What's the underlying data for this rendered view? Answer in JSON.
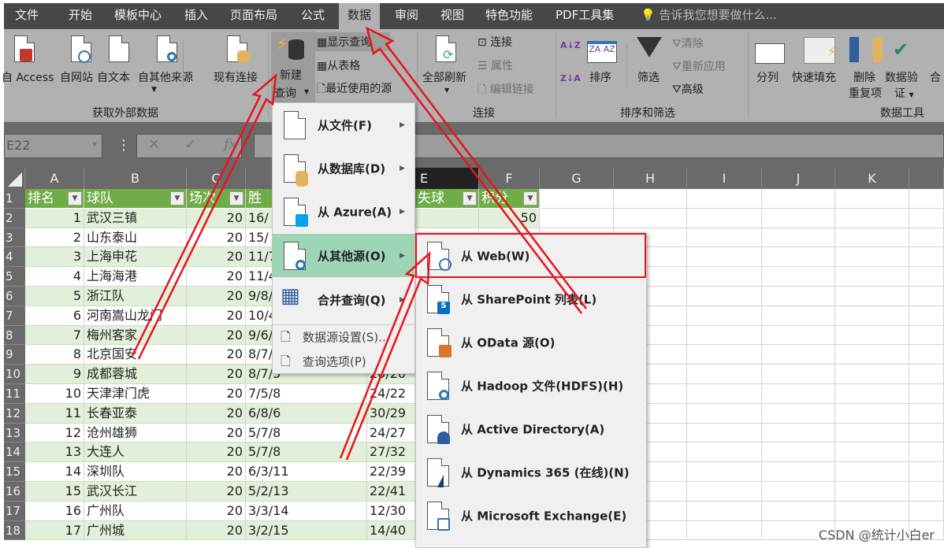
{
  "tabs": [
    "文件",
    "开始",
    "模板中心",
    "插入",
    "页面布局",
    "公式",
    "数据",
    "审阅",
    "视图",
    "特色功能",
    "PDF工具集"
  ],
  "active_tab": "数据",
  "tell_me": "告诉我您想要做什么...",
  "ribbon": {
    "get_external": {
      "access": "自 Access",
      "web": "自网站",
      "text": "自文本",
      "other": "自其他来源",
      "existing": "现有连接",
      "label": "获取外部数据"
    },
    "new_query": {
      "line1": "新建",
      "line2": "查询",
      "show_queries": "显示查询",
      "from_table": "从表格",
      "recent_sources": "最近使用的源"
    },
    "connections": {
      "refresh_all": "全部刷新",
      "connections": "连接",
      "properties": "属性",
      "edit_links": "编辑链接",
      "label": "连接"
    },
    "sort_filter": {
      "sort": "排序",
      "filter": "筛选",
      "clear": "清除",
      "reapply": "重新应用",
      "advanced": "高级",
      "label": "排序和筛选",
      "az": "A↓Z",
      "za": "Z↓A"
    },
    "data_tools": {
      "text_to_columns": "分列",
      "flash_fill": "快速填充",
      "remove_dup1": "删除",
      "remove_dup2": "重复项",
      "validation1": "数据验",
      "validation2": "证",
      "consolidate": "合",
      "label": "数据工具"
    }
  },
  "name_box": "E22",
  "fx": "fx",
  "columns": [
    "A",
    "B",
    "C",
    "E",
    "F",
    "G",
    "H",
    "I",
    "J",
    "K"
  ],
  "header_row": [
    "排名",
    "球队",
    "场次",
    "胜",
    "失球",
    "积分"
  ],
  "rows": [
    {
      "n": "2",
      "rank": "1",
      "team": "武汉三镇",
      "games": "20",
      "wdl": "16/",
      "gf": "",
      "pts": "50"
    },
    {
      "n": "3",
      "rank": "2",
      "team": "山东泰山",
      "games": "20",
      "wdl": "15/",
      "gf": ""
    },
    {
      "n": "4",
      "rank": "3",
      "team": "上海申花",
      "games": "20",
      "wdl": "11/7",
      "gf": ""
    },
    {
      "n": "5",
      "rank": "4",
      "team": "上海海港",
      "games": "20",
      "wdl": "11/4",
      "gf": ""
    },
    {
      "n": "6",
      "rank": "5",
      "team": "浙江队",
      "games": "20",
      "wdl": "9/8/",
      "gf": ""
    },
    {
      "n": "7",
      "rank": "6",
      "team": "河南嵩山龙门",
      "games": "20",
      "wdl": "10/4",
      "gf": ""
    },
    {
      "n": "8",
      "rank": "7",
      "team": "梅州客家",
      "games": "20",
      "wdl": "9/6/",
      "gf": ""
    },
    {
      "n": "9",
      "rank": "8",
      "team": "北京国安",
      "games": "20",
      "wdl": "8/7/",
      "gf": ""
    },
    {
      "n": "10",
      "rank": "9",
      "team": "成都蓉城",
      "games": "20",
      "wdl": "8/7/5",
      "gf": "20/20"
    },
    {
      "n": "11",
      "rank": "10",
      "team": "天津津门虎",
      "games": "20",
      "wdl": "7/5/8",
      "gf": "24/22"
    },
    {
      "n": "12",
      "rank": "11",
      "team": "长春亚泰",
      "games": "20",
      "wdl": "6/8/6",
      "gf": "30/29"
    },
    {
      "n": "13",
      "rank": "12",
      "team": "沧州雄狮",
      "games": "20",
      "wdl": "5/7/8",
      "gf": "24/27"
    },
    {
      "n": "14",
      "rank": "13",
      "team": "大连人",
      "games": "20",
      "wdl": "5/7/8",
      "gf": "27/32"
    },
    {
      "n": "15",
      "rank": "14",
      "team": "深圳队",
      "games": "20",
      "wdl": "6/3/11",
      "gf": "22/39"
    },
    {
      "n": "16",
      "rank": "15",
      "team": "武汉长江",
      "games": "20",
      "wdl": "5/2/13",
      "gf": "22/41"
    },
    {
      "n": "17",
      "rank": "16",
      "team": "广州队",
      "games": "20",
      "wdl": "3/3/14",
      "gf": "12/30"
    },
    {
      "n": "18",
      "rank": "17",
      "team": "广州城",
      "games": "20",
      "wdl": "3/2/15",
      "gf": "14/40"
    }
  ],
  "new_query_menu": [
    {
      "label": "从文件(F)",
      "icon": "file-icon"
    },
    {
      "label": "从数据库(D)",
      "icon": "database-icon"
    },
    {
      "label": "从 Azure(A)",
      "icon": "azure-icon"
    },
    {
      "label": "从其他源(O)",
      "icon": "other-sources-icon",
      "highlighted": true
    },
    {
      "label": "合并查询(Q)",
      "icon": "combine-queries-icon"
    },
    {
      "label": "数据源设置(S)...",
      "icon": "data-source-settings-icon"
    },
    {
      "label": "查询选项(P)",
      "icon": "query-options-icon"
    }
  ],
  "other_sources_menu": [
    {
      "label": "从 Web(W)",
      "icon": "globe-icon",
      "highlighted_box": true
    },
    {
      "label": "从 SharePoint 列表(L)",
      "icon": "sharepoint-icon"
    },
    {
      "label": "从 OData 源(O)",
      "icon": "odata-icon"
    },
    {
      "label": "从 Hadoop 文件(HDFS)(H)",
      "icon": "hadoop-icon"
    },
    {
      "label": "从 Active Directory(A)",
      "icon": "active-directory-icon"
    },
    {
      "label": "从 Dynamics 365 (在线)(N)",
      "icon": "dynamics-icon"
    },
    {
      "label": "从 Microsoft Exchange(E)",
      "icon": "exchange-icon"
    }
  ],
  "watermark": "CSDN @统计小白er",
  "colors": {
    "tab_bar": "#474747",
    "ribbon": "#b1b1b1",
    "table_header": "#70ad47",
    "band": "#e2efda",
    "menu_highlight": "#9fd5b7",
    "annotation": "#e8141c"
  }
}
